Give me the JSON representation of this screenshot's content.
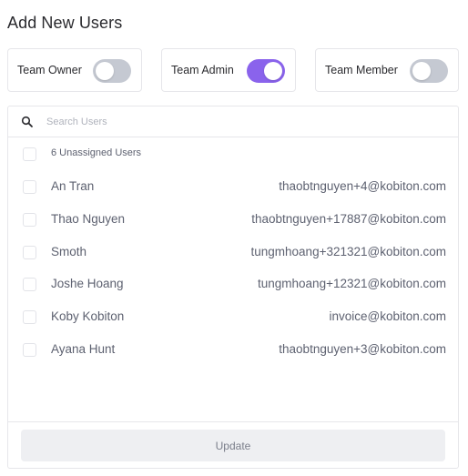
{
  "page": {
    "title": "Add New Users"
  },
  "roles": [
    {
      "label": "Team Owner",
      "enabled": false
    },
    {
      "label": "Team Admin",
      "enabled": true
    },
    {
      "label": "Team Member",
      "enabled": false
    }
  ],
  "search": {
    "placeholder": "Search Users",
    "value": ""
  },
  "unassigned": {
    "label": "6 Unassigned Users",
    "checked": false
  },
  "users": [
    {
      "name": "An Tran",
      "email": "thaobtnguyen+4@kobiton.com",
      "checked": false
    },
    {
      "name": "Thao Nguyen",
      "email": "thaobtnguyen+17887@kobiton.com",
      "checked": false
    },
    {
      "name": "Smoth",
      "email": "tungmhoang+321321@kobiton.com",
      "checked": false
    },
    {
      "name": "Joshe Hoang",
      "email": "tungmhoang+12321@kobiton.com",
      "checked": false
    },
    {
      "name": "Koby Kobiton",
      "email": "invoice@kobiton.com",
      "checked": false
    },
    {
      "name": "Ayana Hunt",
      "email": "thaobtnguyen+3@kobiton.com",
      "checked": false
    }
  ],
  "footer": {
    "update_label": "Update"
  },
  "colors": {
    "accent": "#8a63ec",
    "toggle_off": "#c5c9d2",
    "text_muted": "#5d6170"
  }
}
